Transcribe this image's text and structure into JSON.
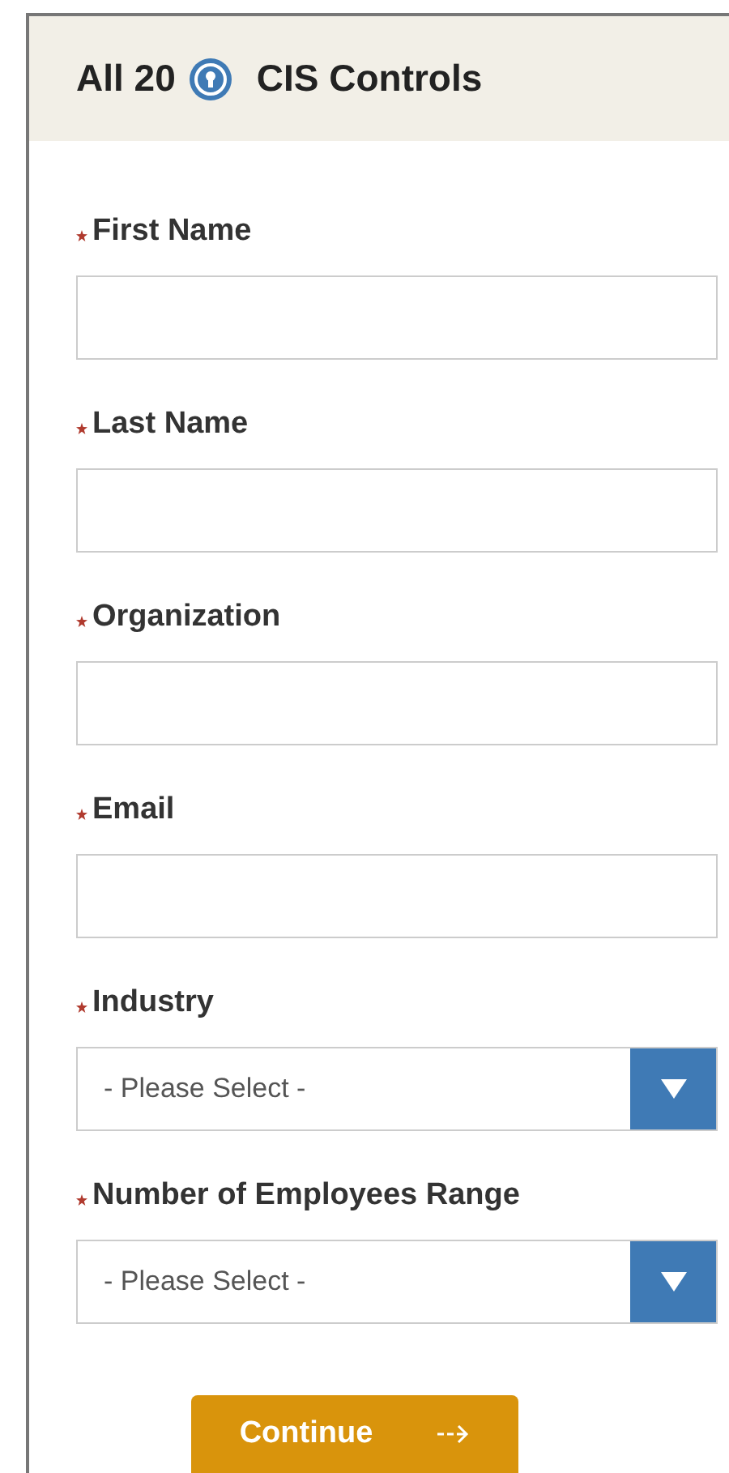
{
  "header": {
    "title_before": "All 20",
    "title_after": "CIS Controls"
  },
  "fields": [
    {
      "label": "First Name",
      "kind": "text",
      "required": true
    },
    {
      "label": "Last Name",
      "kind": "text",
      "required": true
    },
    {
      "label": "Organization",
      "kind": "text",
      "required": true
    },
    {
      "label": "Email",
      "kind": "text",
      "required": true
    },
    {
      "label": "Industry",
      "kind": "select",
      "required": true,
      "value": "- Please Select -"
    },
    {
      "label": "Number of Employees Range",
      "kind": "select",
      "required": true,
      "value": "- Please Select -"
    }
  ],
  "submit": {
    "label": "Continue"
  }
}
